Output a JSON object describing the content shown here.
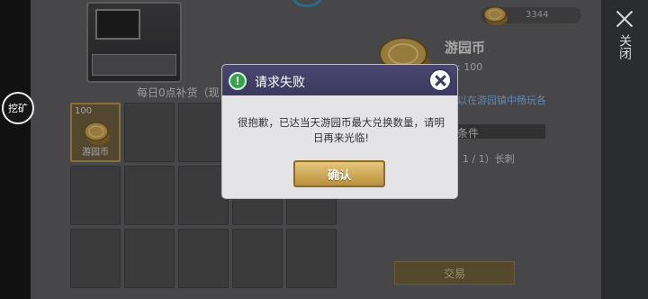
{
  "left": {
    "mine_label": "挖矿"
  },
  "right": {
    "close_label": "关闭"
  },
  "shop": {
    "restock_text": "每日0点补货（现",
    "wallet_amount": "3344",
    "selected_item": {
      "quantity": "100",
      "name": "游园币"
    },
    "detail": {
      "title": "游园币",
      "price": ": 100",
      "description": "以在游园镇中畅玩各",
      "condition_label": "条件",
      "requirement": "1 / 1）长刺"
    },
    "trade_label": "交易"
  },
  "dialog": {
    "title": "请求失败",
    "message": "很抱歉，已达当天游园币最大兑换数量，请明日再来光临!",
    "confirm_label": "确认"
  },
  "colors": {
    "dialog_header": "#3c3960",
    "confirm_gold": "#d7b260",
    "alert_green": "#35a447"
  }
}
